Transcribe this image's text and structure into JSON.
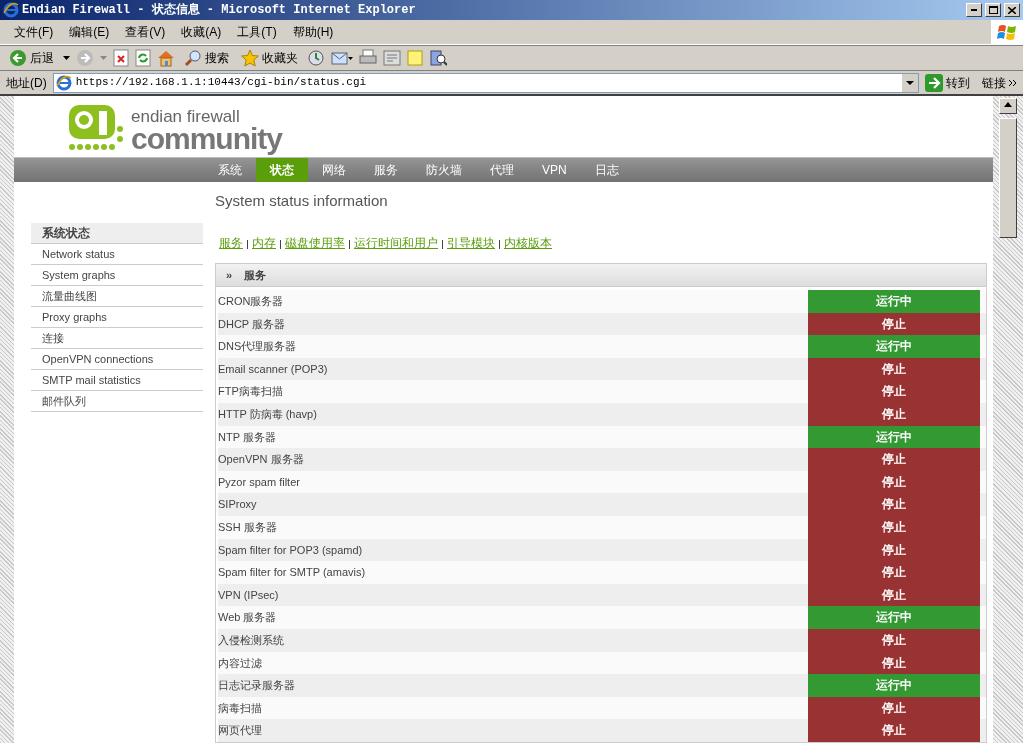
{
  "window": {
    "title": "Endian Firewall - 状态信息 - Microsoft Internet Explorer"
  },
  "menu": [
    "文件(F)",
    "编辑(E)",
    "查看(V)",
    "收藏(A)",
    "工具(T)",
    "帮助(H)"
  ],
  "toolbar": {
    "back": "后退",
    "search": "搜索",
    "favorites": "收藏夹"
  },
  "address": {
    "label": "地址(D)",
    "url": "https://192.168.1.1:10443/cgi-bin/status.cgi",
    "go": "转到",
    "links": "链接"
  },
  "logo": {
    "line1": "endian firewall",
    "line2": "community"
  },
  "nav": [
    {
      "label": "系统",
      "selected": false
    },
    {
      "label": "状态",
      "selected": true
    },
    {
      "label": "网络",
      "selected": false
    },
    {
      "label": "服务",
      "selected": false
    },
    {
      "label": "防火墙",
      "selected": false
    },
    {
      "label": "代理",
      "selected": false
    },
    {
      "label": "VPN",
      "selected": false
    },
    {
      "label": "日志",
      "selected": false
    }
  ],
  "page_title": "System status information",
  "sidebar": {
    "title": "系统状态",
    "items": [
      "Network status",
      "System graphs",
      "流量曲线图",
      "Proxy graphs",
      "连接",
      "OpenVPN connections",
      "SMTP mail statistics",
      "邮件队列"
    ]
  },
  "section_links": [
    "服务",
    "内存",
    "磁盘使用率",
    "运行时间和用户",
    "引导模块",
    "内核版本"
  ],
  "panel": {
    "expander": "»",
    "title": "服务"
  },
  "services": [
    {
      "name": "CRON服务器",
      "running": true,
      "status": "运行中"
    },
    {
      "name": "DHCP 服务器",
      "running": false,
      "status": "停止"
    },
    {
      "name": "DNS代理服务器",
      "running": true,
      "status": "运行中"
    },
    {
      "name": "Email scanner (POP3)",
      "running": false,
      "status": "停止"
    },
    {
      "name": "FTP病毒扫描",
      "running": false,
      "status": "停止"
    },
    {
      "name": "HTTP 防病毒 (havp)",
      "running": false,
      "status": "停止"
    },
    {
      "name": "NTP 服务器",
      "running": true,
      "status": "运行中"
    },
    {
      "name": "OpenVPN 服务器",
      "running": false,
      "status": "停止"
    },
    {
      "name": "Pyzor spam filter",
      "running": false,
      "status": "停止"
    },
    {
      "name": "SIProxy",
      "running": false,
      "status": "停止"
    },
    {
      "name": "SSH 服务器",
      "running": false,
      "status": "停止"
    },
    {
      "name": "Spam filter for POP3 (spamd)",
      "running": false,
      "status": "停止"
    },
    {
      "name": "Spam filter for SMTP (amavis)",
      "running": false,
      "status": "停止"
    },
    {
      "name": "VPN (IPsec)",
      "running": false,
      "status": "停止"
    },
    {
      "name": "Web 服务器",
      "running": true,
      "status": "运行中"
    },
    {
      "name": "入侵检测系统",
      "running": false,
      "status": "停止"
    },
    {
      "name": "内容过滤",
      "running": false,
      "status": "停止"
    },
    {
      "name": "日志记录服务器",
      "running": true,
      "status": "运行中"
    },
    {
      "name": "病毒扫描",
      "running": false,
      "status": "停止"
    },
    {
      "name": "网页代理",
      "running": false,
      "status": "停止"
    }
  ]
}
